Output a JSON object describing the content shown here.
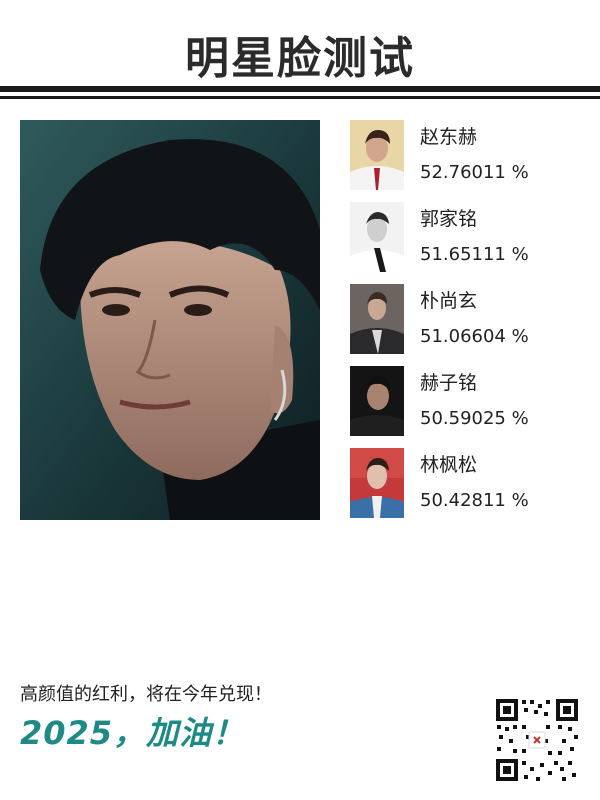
{
  "header": {
    "title": "明星脸测试"
  },
  "matches": [
    {
      "name": "赵东赫",
      "score": "52.76011 %"
    },
    {
      "name": "郭家铭",
      "score": "51.65111 %"
    },
    {
      "name": "朴尚玄",
      "score": "51.06604 %"
    },
    {
      "name": "赫子铭",
      "score": "50.59025 %"
    },
    {
      "name": "林枫松",
      "score": "50.42811 %"
    }
  ],
  "footer": {
    "slogan": "高颜值的红利，将在今年兑现！",
    "cheer": "2025，加油！"
  },
  "colors": {
    "accent": "#1e8a86",
    "title": "#2b2b2b",
    "rule": "#1a1a1a"
  }
}
